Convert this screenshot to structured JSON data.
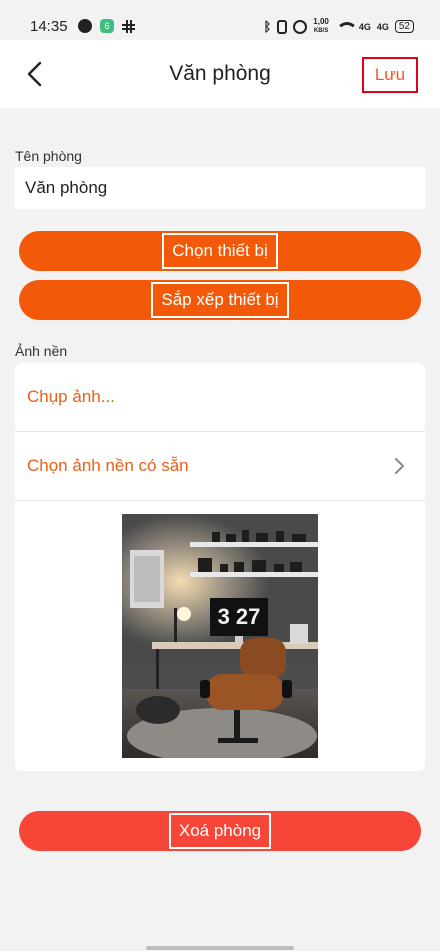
{
  "status_bar": {
    "time": "14:35",
    "speed_top": "1,00",
    "speed_bottom": "KB/S",
    "signal1": "4G",
    "signal2": "4G",
    "battery": "52",
    "left_icons": [
      "messenger-icon",
      "app-badge-icon",
      "slack-icon"
    ],
    "right_icons": [
      "bluetooth-icon",
      "vibrate-icon",
      "alarm-icon",
      "data-speed",
      "wifi-icon",
      "signal-icon",
      "signal-icon",
      "battery-icon"
    ]
  },
  "header": {
    "title": "Văn phòng",
    "save_label": "Lưu",
    "back_icon": "chevron-left-icon"
  },
  "room": {
    "name_label": "Tên phòng",
    "name_value": "Văn phòng"
  },
  "actions": {
    "select_devices": "Chọn thiết bị",
    "arrange_devices": "Sắp xếp thiết bị",
    "delete_room": "Xoá phòng"
  },
  "background": {
    "section_label": "Ảnh nền",
    "take_photo": "Chụp ảnh...",
    "choose_preset": "Chọn ảnh nền có sẵn",
    "preview_clock": "3 27"
  },
  "colors": {
    "accent": "#f25a0a",
    "delete": "#f64638",
    "link_text": "#e9601a",
    "highlight_border": "#e2001a"
  }
}
